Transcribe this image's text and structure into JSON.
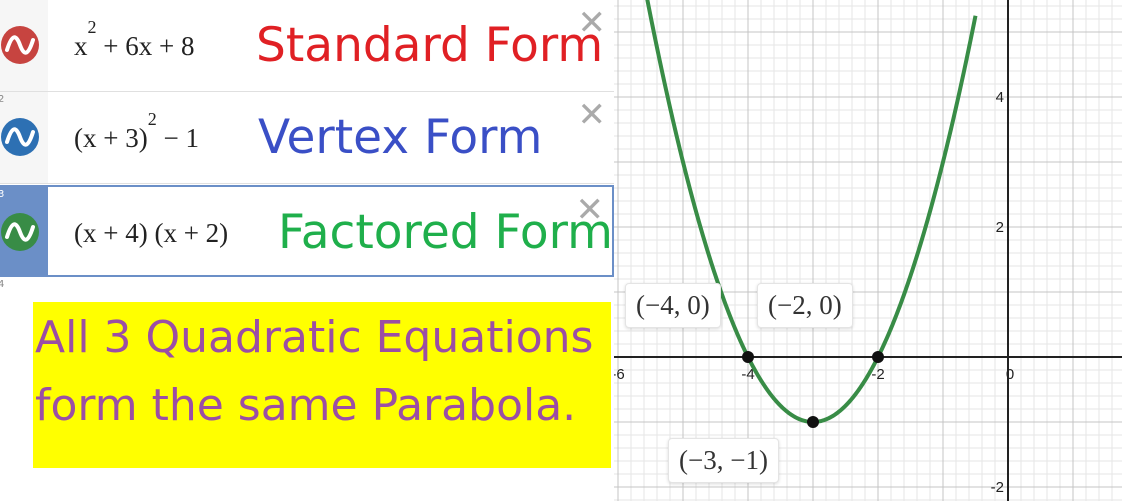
{
  "expressions": [
    {
      "math_html": "x<sup>2</sup> + 6x + 8",
      "label": "Standard Form",
      "label_color": "#e02024",
      "icon_color": "#c74440",
      "icon": "curve-icon"
    },
    {
      "math_html": "(x + 3)<sup>2</sup> − 1",
      "label": "Vertex Form",
      "label_color": "#3a4fc6",
      "icon_color": "#2d70b3",
      "icon": "curve-icon"
    },
    {
      "math_html": "(x + 4) (x + 2)",
      "label": "Factored Form",
      "label_color": "#1faf4b",
      "icon_color": "#388c46",
      "icon": "curve-icon"
    }
  ],
  "row_indices": [
    "2",
    "3",
    "4"
  ],
  "note": {
    "line1": "All 3 Quadratic Equations",
    "line2": "form the same Parabola.",
    "background": "#ffff00",
    "text_color": "#9b4ea5"
  },
  "graph": {
    "x_ticks": [
      "-6",
      "-4",
      "-2",
      "0"
    ],
    "y_ticks": [
      "4",
      "2",
      "-2"
    ],
    "curve_color": "#388c46",
    "points": [
      {
        "x": -4,
        "y": 0,
        "label": "(−4, 0)"
      },
      {
        "x": -2,
        "y": 0,
        "label": "(−2, 0)"
      },
      {
        "x": -3,
        "y": -1,
        "label": "(−3, −1)"
      }
    ]
  }
}
